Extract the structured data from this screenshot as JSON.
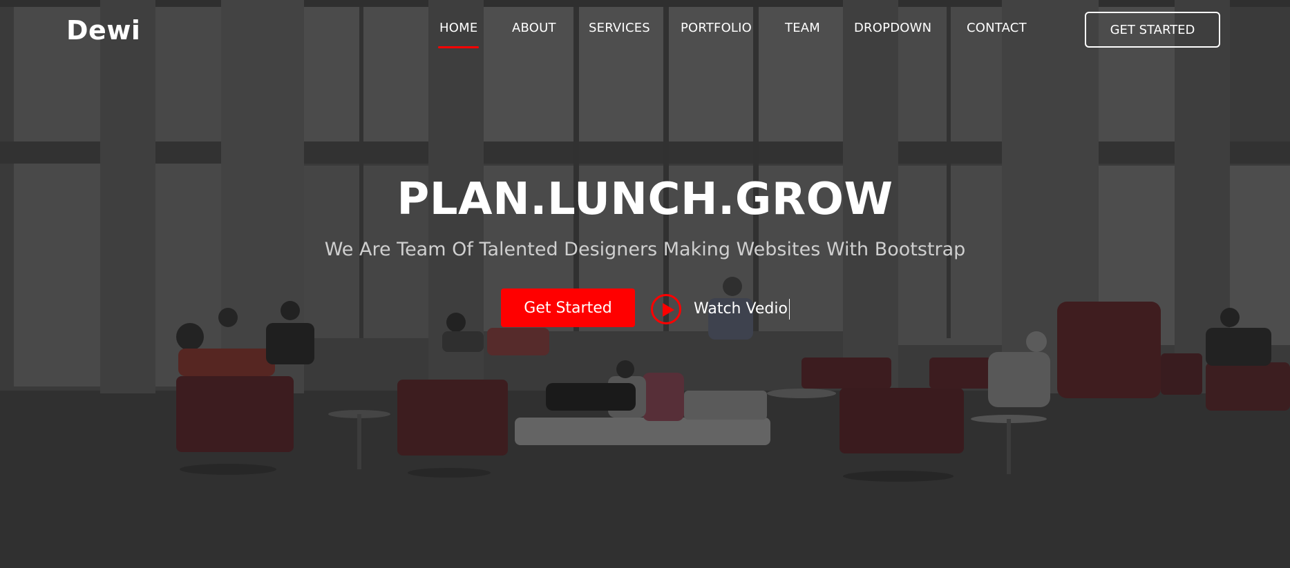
{
  "header": {
    "logo": "Dewi",
    "nav": [
      {
        "label": "HOME",
        "active": true
      },
      {
        "label": "ABOUT",
        "active": false
      },
      {
        "label": "SERVICES",
        "active": false
      },
      {
        "label": "PORTFOLIO",
        "active": false
      },
      {
        "label": "TEAM",
        "active": false
      },
      {
        "label": "DROPDOWN",
        "active": false
      },
      {
        "label": "CONTACT",
        "active": false
      }
    ],
    "cta_label": "GET STARTED"
  },
  "hero": {
    "title": "PLAN.LUNCH.GROW",
    "subtitle": "We Are Team Of Talented Designers Making Websites With Bootstrap",
    "primary_button": "Get Started",
    "video_link": "Watch Vedio"
  },
  "colors": {
    "accent": "#ff0000",
    "text": "#ffffff",
    "subtitle": "#cfcfcf"
  },
  "icons": {
    "play": "play-icon"
  }
}
